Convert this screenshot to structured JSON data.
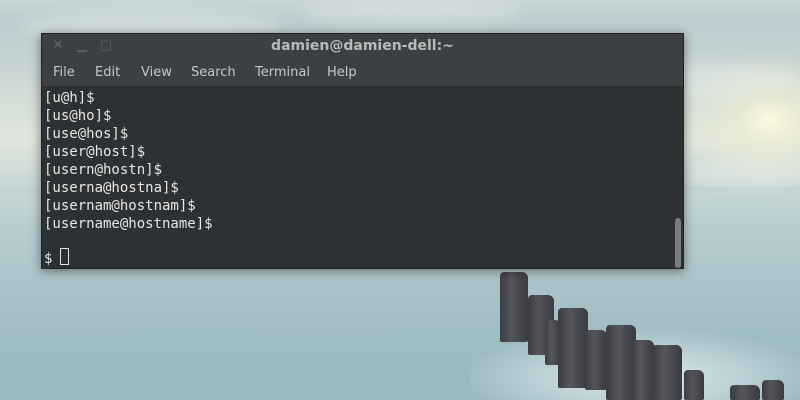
{
  "window": {
    "title": "damien@damien-dell:~",
    "controls": {
      "close_icon": "close-icon",
      "minimize_icon": "minimize-icon",
      "maximize_icon": "maximize-icon"
    }
  },
  "menu": {
    "items": [
      {
        "label": "File"
      },
      {
        "label": "Edit"
      },
      {
        "label": "View"
      },
      {
        "label": "Search"
      },
      {
        "label": "Terminal"
      },
      {
        "label": "Help"
      }
    ]
  },
  "terminal": {
    "lines": [
      "[u@h]$",
      "[us@ho]$",
      "[use@hos]$",
      "[user@host]$",
      "[usern@hostn]$",
      "[userna@hostna]$",
      "[usernam@hostnam]$",
      "[username@hostname]$",
      ""
    ],
    "prompt": "$ "
  },
  "colors": {
    "terminal_bg": "#2e3133",
    "titlebar_bg": "#3d4042",
    "text": "#e6e6e6",
    "menu_text": "#c4c7c7"
  }
}
